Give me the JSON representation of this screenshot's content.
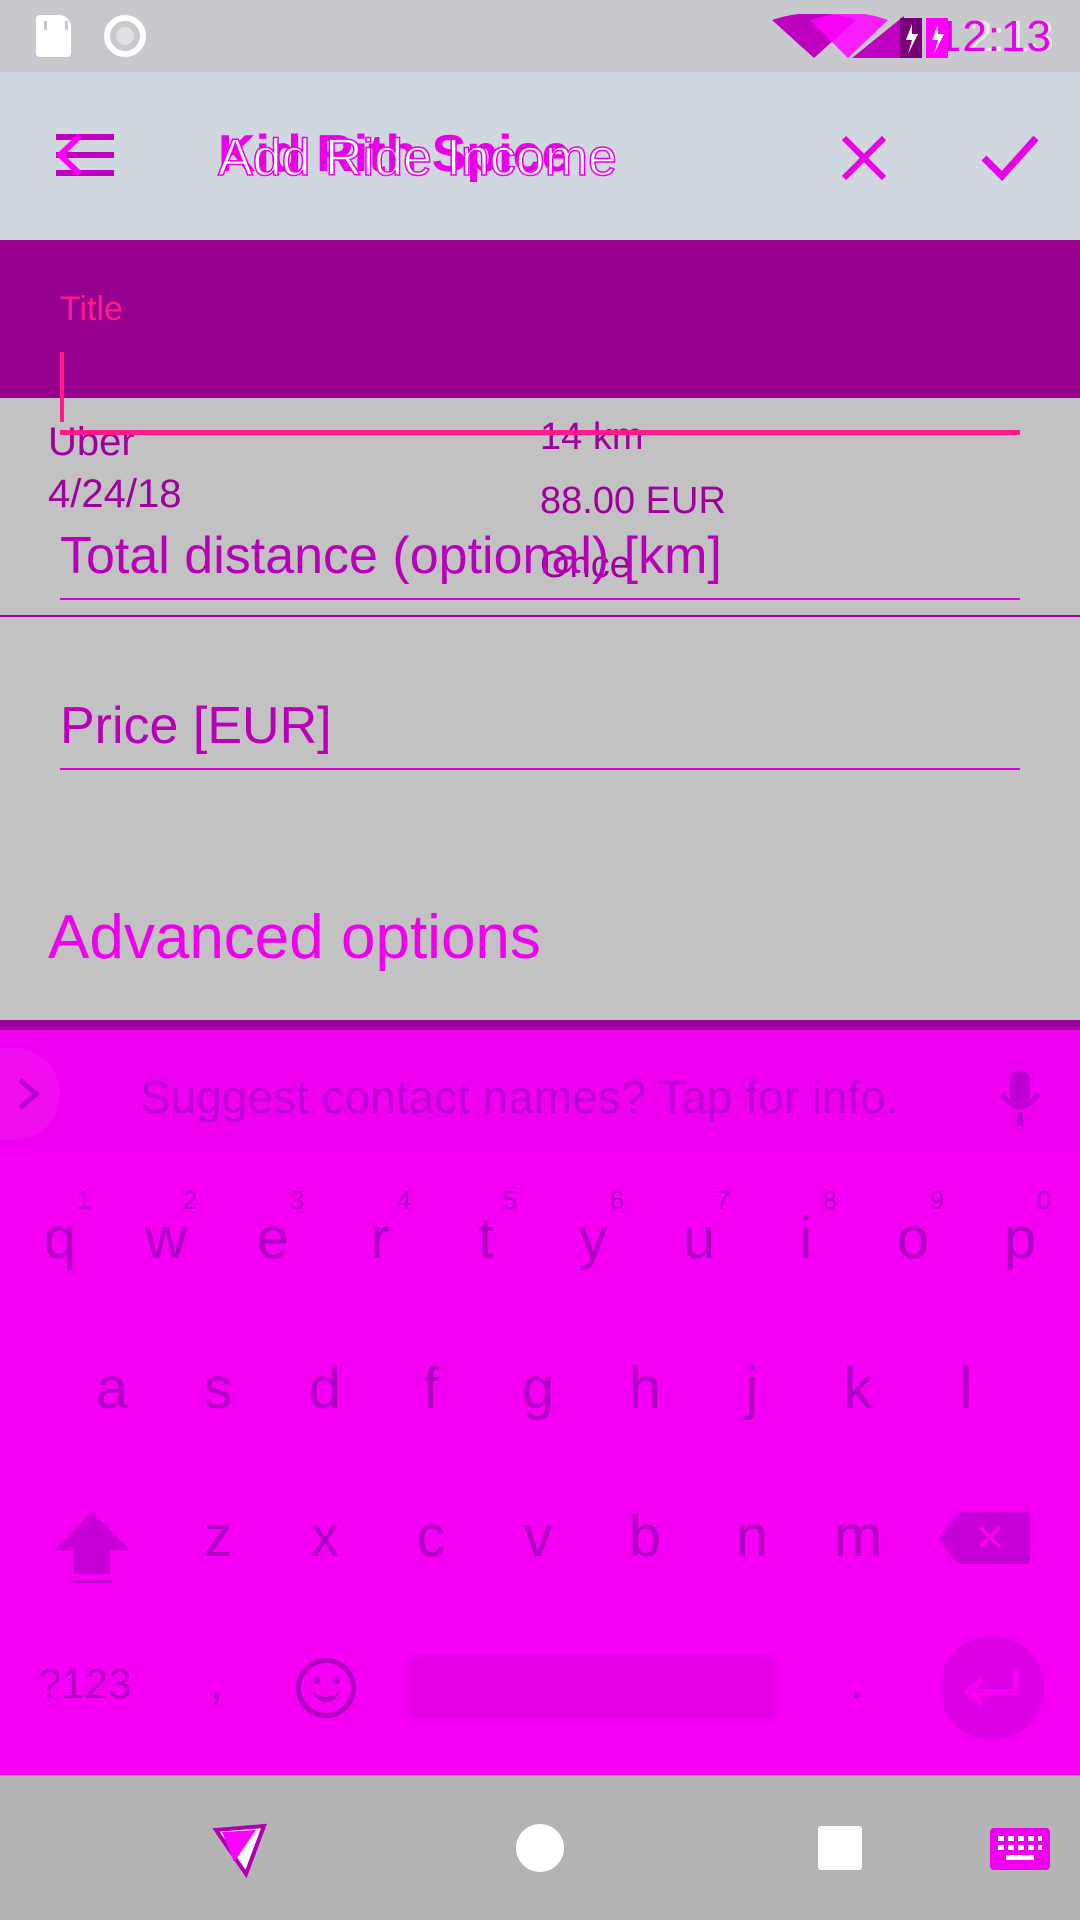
{
  "status_bar": {
    "time": "12:13",
    "time_ghost": "2:13",
    "sd_icon": "sd-card-icon",
    "sync_icon": "sync-icon",
    "wifi_icon": "wifi-icon",
    "signal_icon": "signal-icon",
    "battery_icon": "battery-charging-icon"
  },
  "toolbar": {
    "menu_icon": "menu-icon",
    "title": "Add Ride Income",
    "title_overlay": "Kid Rith Spice",
    "close_icon": "close-icon",
    "confirm_icon": "check-icon"
  },
  "form": {
    "title_label": "Title",
    "title_value": "",
    "distance_label": "Total distance (optional) [km]",
    "price_label": "Price [EUR]",
    "advanced_label": "Advanced options"
  },
  "background_item": {
    "name": "Uber",
    "date": "4/24/18",
    "distance": "14 km",
    "price": "88.00 EUR",
    "frequency": "Once"
  },
  "keyboard": {
    "suggestion_text": "Suggest contact names? Tap for info.",
    "row1": [
      "q",
      "w",
      "e",
      "r",
      "t",
      "y",
      "u",
      "i",
      "o",
      "p"
    ],
    "row1_numbers": [
      "1",
      "2",
      "3",
      "4",
      "5",
      "6",
      "7",
      "8",
      "9",
      "0"
    ],
    "row2": [
      "a",
      "s",
      "d",
      "f",
      "g",
      "h",
      "j",
      "k",
      "l"
    ],
    "row3": [
      "z",
      "x",
      "c",
      "v",
      "b",
      "n",
      "m"
    ],
    "symbols_key": "?123",
    "comma_key": ",",
    "period_key": "."
  },
  "nav_bar": {
    "back_icon": "back-icon",
    "home_icon": "home-icon",
    "recents_icon": "recents-icon",
    "keyboard_icon": "keyboard-icon"
  }
}
